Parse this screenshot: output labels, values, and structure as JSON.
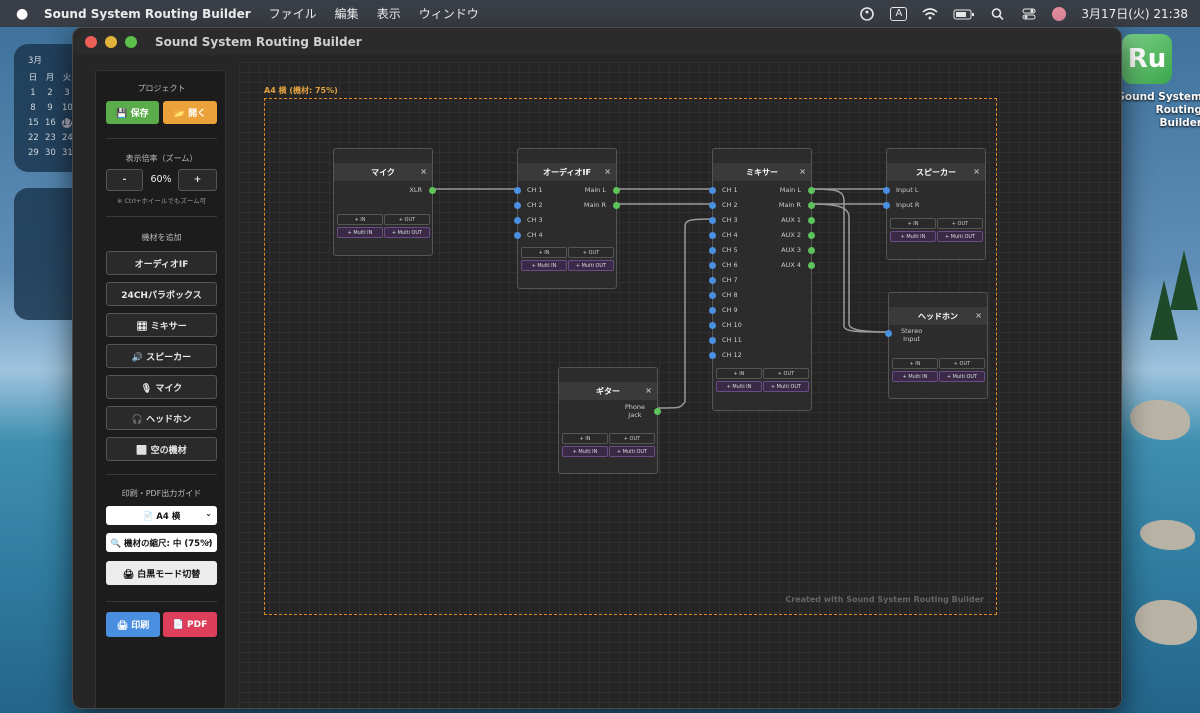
{
  "menubar": {
    "app_name": "Sound System Routing Builder",
    "menus": [
      "ファイル",
      "編集",
      "表示",
      "ウィンドウ"
    ],
    "input_mode": "A",
    "datetime": "3月17日(火)  21:38"
  },
  "calendar_widget": {
    "month": "3月",
    "weekday_header": [
      "日",
      "月",
      "火"
    ],
    "rows": [
      [
        "1",
        "2",
        "3"
      ],
      [
        "8",
        "9",
        "10"
      ],
      [
        "15",
        "16",
        "17"
      ],
      [
        "22",
        "23",
        "24"
      ],
      [
        "29",
        "30",
        "31"
      ]
    ],
    "today": "17"
  },
  "desktop_icon": {
    "icon_text": "Ru",
    "label": "Sound System Routing Builder"
  },
  "window": {
    "title": "Sound System Routing Builder"
  },
  "sidebar": {
    "project_heading": "プロジェクト",
    "save_label": "💾 保存",
    "open_label": "📂 開く",
    "zoom_heading": "表示倍率（ズーム）",
    "zoom_out_label": "-",
    "zoom_value": "60%",
    "zoom_in_label": "+",
    "zoom_hint": "※ Ctrl+ホイールでもズーム可",
    "add_heading": "機材を追加",
    "add_buttons": [
      "オーディオIF",
      "24CHパラボックス",
      "🎛 ミキサー",
      "🔊 スピーカー",
      "🎙 マイク",
      "🎧 ヘッドホン",
      "⬜ 空の機材"
    ],
    "print_heading": "印刷・PDF出力ガイド",
    "paper_select": "📄 A4 横",
    "scale_select": "🔍 機材の縮尺: 中 (75%)",
    "bw_mode_label": "🖨 白黒モード切替",
    "print_label": "🖨 印刷",
    "pdf_label": "📄 PDF",
    "colors": {
      "save": "#5aad4a",
      "open": "#eba23a",
      "print": "#4a8ee0",
      "pdf": "#dd3f5a"
    }
  },
  "canvas": {
    "page_label": "A4 横 (機材: 75%)",
    "credit": "Created with Sound System Routing Builder",
    "frame_color": "#e08a2a"
  },
  "devices": {
    "mic": {
      "title": "マイク",
      "close": "×",
      "outputs": [
        "XLR"
      ],
      "buttons": {
        "in": "+ IN",
        "out": "+ OUT",
        "multi_in": "+ Multi IN",
        "multi_out": "+ Multi OUT"
      }
    },
    "audio_if": {
      "title": "オーディオIF",
      "close": "×",
      "inputs": [
        "CH 1",
        "CH 2",
        "CH 3",
        "CH 4"
      ],
      "outputs": [
        "Main L",
        "Main R"
      ],
      "buttons": {
        "in": "+ IN",
        "out": "+ OUT",
        "multi_in": "+ Multi IN",
        "multi_out": "+ Multi OUT"
      }
    },
    "mixer": {
      "title": "ミキサー",
      "close": "×",
      "inputs": [
        "CH 1",
        "CH 2",
        "CH 3",
        "CH 4",
        "CH 5",
        "CH 6",
        "CH 7",
        "CH 8",
        "CH 9",
        "CH 10",
        "CH 11",
        "CH 12"
      ],
      "outputs": [
        "Main L",
        "Main R",
        "AUX 1",
        "AUX 2",
        "AUX 3",
        "AUX 4"
      ],
      "buttons": {
        "in": "+ IN",
        "out": "+ OUT",
        "multi_in": "+ Multi IN",
        "multi_out": "+ Multi OUT"
      }
    },
    "speaker": {
      "title": "スピーカー",
      "close": "×",
      "inputs": [
        "Input L",
        "Input R"
      ],
      "buttons": {
        "in": "+ IN",
        "out": "+ OUT",
        "multi_in": "+ Multi IN",
        "multi_out": "+ Multi OUT"
      }
    },
    "guitar": {
      "title": "ギター",
      "close": "×",
      "outputs": [
        "Phone\nJack"
      ],
      "buttons": {
        "in": "+ IN",
        "out": "+ OUT",
        "multi_in": "+ Multi IN",
        "multi_out": "+ Multi OUT"
      }
    },
    "headphone": {
      "title": "ヘッドホン",
      "close": "×",
      "inputs": [
        "Stereo\nInput"
      ],
      "buttons": {
        "in": "+ IN",
        "out": "+ OUT",
        "multi_in": "+ Multi IN",
        "multi_out": "+ Multi OUT"
      }
    }
  }
}
